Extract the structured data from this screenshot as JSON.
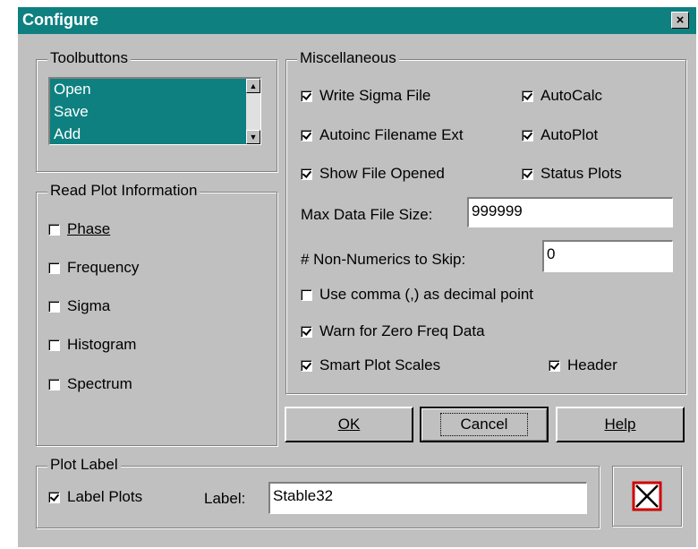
{
  "window": {
    "title": "Configure",
    "close_glyph": "×"
  },
  "toolbuttons": {
    "legend": "Toolbuttons",
    "items": [
      "Open",
      "Save",
      "Add"
    ]
  },
  "read_plot": {
    "legend": "Read Plot Information",
    "items": [
      {
        "label": "Phase",
        "checked": false
      },
      {
        "label": "Frequency",
        "checked": false
      },
      {
        "label": "Sigma",
        "checked": false
      },
      {
        "label": "Histogram",
        "checked": false
      },
      {
        "label": "Spectrum",
        "checked": false
      }
    ]
  },
  "misc": {
    "legend": "Miscellaneous",
    "write_sigma": {
      "label": "Write Sigma File",
      "checked": true
    },
    "autocalc": {
      "label": "AutoCalc",
      "checked": true
    },
    "autoinc": {
      "label": "Autoinc Filename Ext",
      "checked": true
    },
    "autoplot": {
      "label": "AutoPlot",
      "checked": true
    },
    "show_file": {
      "label": "Show File Opened",
      "checked": true
    },
    "status_plots": {
      "label": "Status Plots",
      "checked": true
    },
    "max_size_label": "Max Data File Size:",
    "max_size_value": "999999",
    "nonnumerics_label": "# Non-Numerics to Skip:",
    "nonnumerics_value": "0",
    "use_comma": {
      "label": "Use comma (,) as decimal point",
      "checked": false
    },
    "warn_zero": {
      "label": "Warn for Zero Freq Data",
      "checked": true
    },
    "smart_scales": {
      "label": "Smart Plot Scales",
      "checked": true
    },
    "header": {
      "label": "Header",
      "checked": true
    }
  },
  "buttons": {
    "ok": "OK",
    "cancel": "Cancel",
    "help": "Help"
  },
  "plot_label": {
    "legend": "Plot Label",
    "label_plots": {
      "label": "Label Plots",
      "checked": true
    },
    "label_caption": "Label:",
    "label_value": "Stable32"
  },
  "icons": {
    "scroll_up": "▲",
    "scroll_down": "▼",
    "clear_icon": "red-box-x"
  },
  "colors": {
    "title_bar": "#0e8080",
    "face": "#c0c0c0",
    "list_highlight": "#0e8080"
  }
}
